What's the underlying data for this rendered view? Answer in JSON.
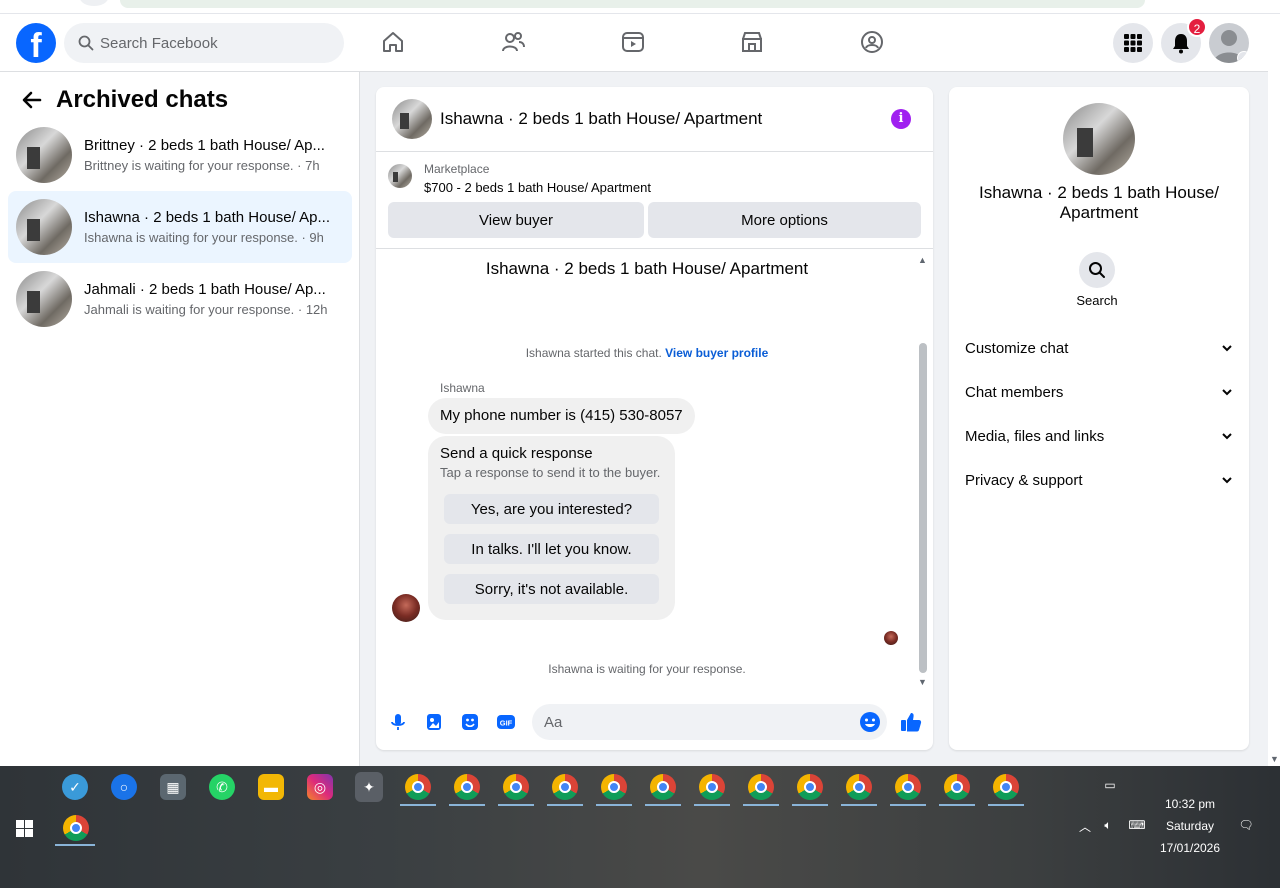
{
  "nav": {
    "logo": "f",
    "search_placeholder": "Search Facebook",
    "notification_count": "2"
  },
  "sidebar": {
    "title": "Archived chats",
    "chats": [
      {
        "title": "Brittney · 2 beds 1 bath House/ Ap...",
        "subtitle": "Brittney is waiting for your response. · 7h"
      },
      {
        "title": "Ishawna · 2 beds 1 bath House/ Ap...",
        "subtitle": "Ishawna is waiting for your response. · 9h"
      },
      {
        "title": "Jahmali · 2 beds 1 bath House/ Ap...",
        "subtitle": "Jahmali is waiting for your response. · 12h"
      }
    ]
  },
  "chat": {
    "header_title": "Ishawna · 2 beds 1 bath House/ Apartment",
    "info_icon": "i",
    "marketplace_label": "Marketplace",
    "marketplace_listing": "$700 - 2 beds 1 bath House/ Apartment",
    "view_buyer": "View buyer",
    "more_options": "More options",
    "conversation_title": "Ishawna · 2 beds 1 bath House/ Apartment",
    "started_text": "Ishawna started this chat. ",
    "view_buyer_profile": "View buyer profile",
    "sender_name": "Ishawna",
    "message": "My phone number is (415) 530-8057",
    "quick_title": "Send a quick response",
    "quick_subtitle": "Tap a response to send it to the buyer.",
    "quick_options": [
      "Yes, are you interested?",
      "In talks. I'll let you know.",
      "Sorry, it's not available."
    ],
    "waiting_text": "Ishawna is waiting for your response.",
    "input_placeholder": "Aa"
  },
  "info_panel": {
    "title": "Ishawna · 2 beds 1 bath House/ Apartment",
    "search_label": "Search",
    "sections": [
      "Customize chat",
      "Chat members",
      "Media, files and links",
      "Privacy & support"
    ]
  },
  "taskbar": {
    "time": "10:32 pm",
    "day": "Saturday",
    "date": "17/01/2026"
  },
  "colors": {
    "brand": "#0866ff",
    "active_chat_bg": "#ebf5ff",
    "badge": "#e41e3f",
    "info_icon": "#a020f0"
  }
}
